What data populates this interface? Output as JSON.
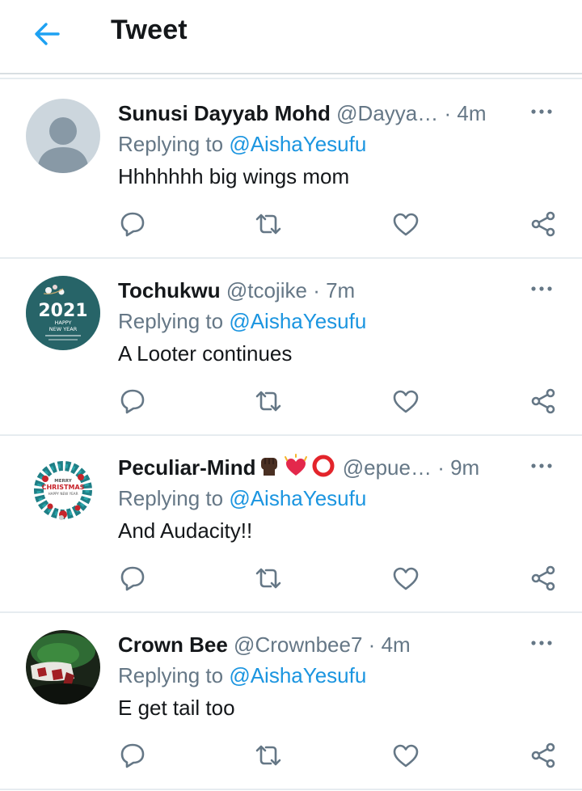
{
  "header": {
    "title": "Tweet",
    "back_icon": "arrow-left-icon",
    "accent_color": "#1da1f2"
  },
  "replies": [
    {
      "name": "Sunusi Dayyab Mohd",
      "handle": "@Dayya…",
      "dot": "·",
      "time": "4m",
      "replying_label": "Replying to",
      "replying_to": "@AishaYesufu",
      "text": "Hhhhhhh big wings mom",
      "avatar": "default-avatar"
    },
    {
      "name": "Tochukwu",
      "handle": "@tcojike",
      "dot": "·",
      "time": "7m",
      "replying_label": "Replying to",
      "replying_to": "@AishaYesufu",
      "text": "A Looter continues",
      "avatar": "new-year-2021-avatar",
      "avatar_text": {
        "year": "2021",
        "line1": "HAPPY",
        "line2": "NEW YEAR"
      }
    },
    {
      "name": "Peculiar-Mind",
      "emojis": [
        "raised-fist-icon",
        "sparkling-heart-icon",
        "red-circle-icon"
      ],
      "handle": "@epue…",
      "dot": "·",
      "time": "9m",
      "replying_label": "Replying to",
      "replying_to": "@AishaYesufu",
      "text": "And Audacity!!",
      "avatar": "christmas-wreath-avatar",
      "avatar_text": {
        "line1": "MERRY",
        "line2": "CHRISTMAS",
        "line3": "HAPPY NEW YEAR"
      }
    },
    {
      "name": "Crown Bee",
      "handle": "@Crownbee7",
      "dot": "·",
      "time": "4m",
      "replying_label": "Replying to",
      "replying_to": "@AishaYesufu",
      "text": "E get tail too",
      "avatar": "green-red-photo-avatar"
    }
  ],
  "action_icons": [
    "reply-icon",
    "retweet-icon",
    "like-icon",
    "share-icon"
  ],
  "colors": {
    "name": "#14171a",
    "secondary": "#657786",
    "link": "#1b95e0",
    "divider": "#e6ecf0"
  }
}
